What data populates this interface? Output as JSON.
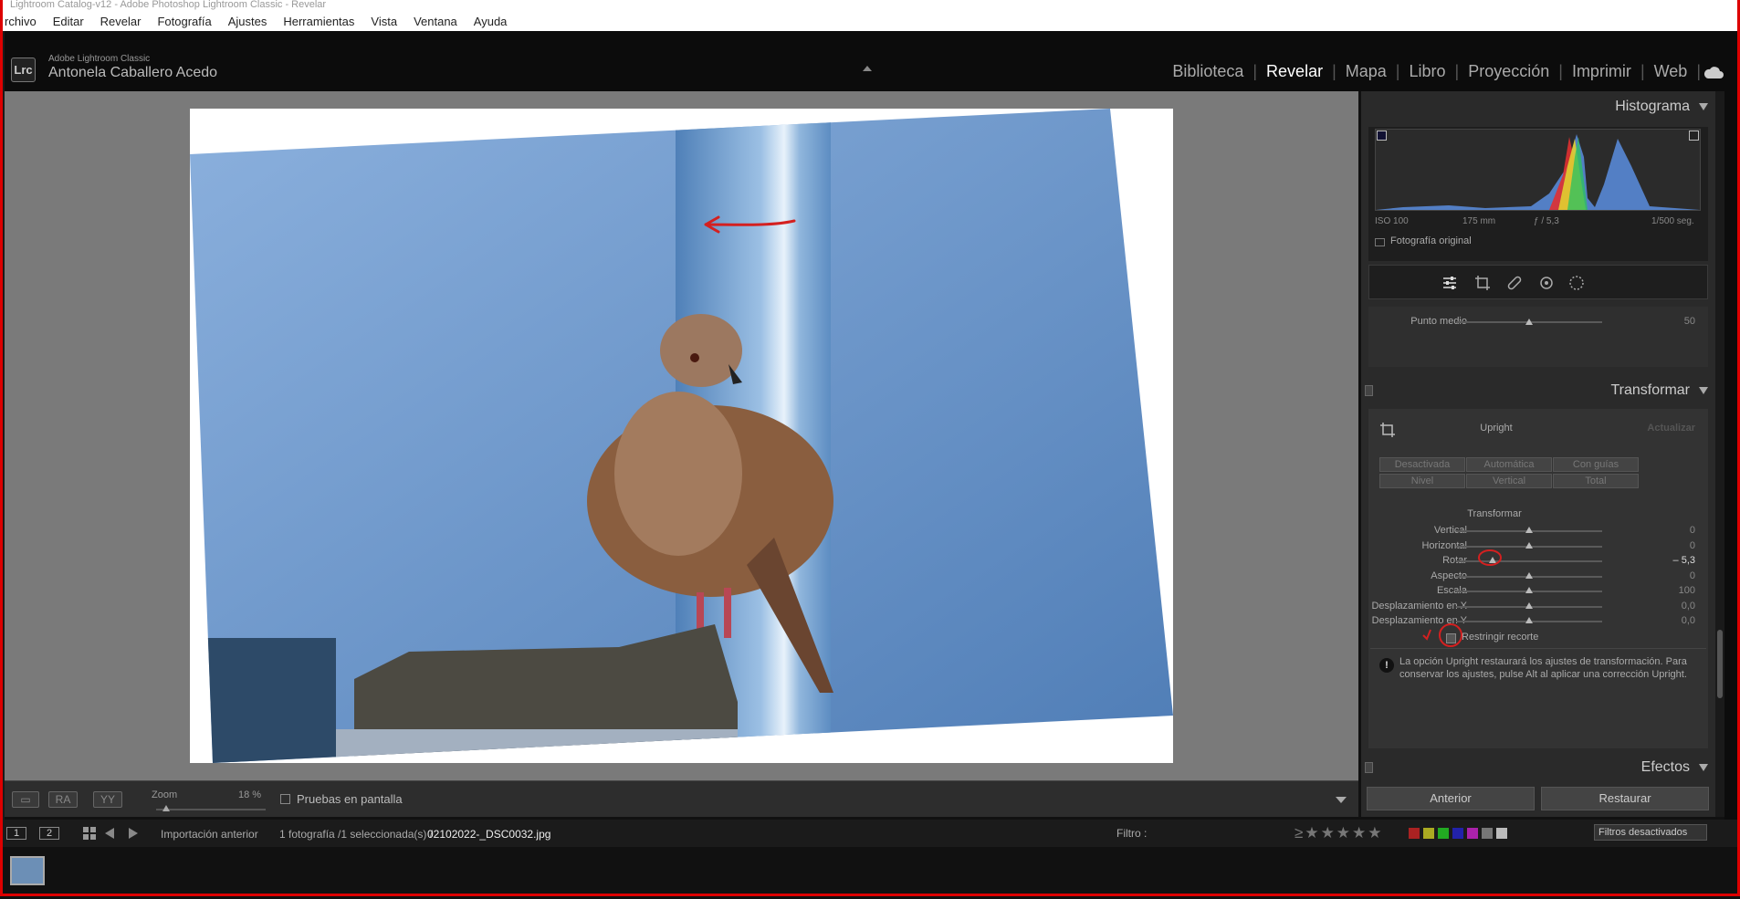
{
  "window": {
    "title": "Lightroom Catalog-v12 - Adobe Photoshop Lightroom Classic - Revelar"
  },
  "menu": [
    "rchivo",
    "Editar",
    "Revelar",
    "Fotografía",
    "Ajustes",
    "Herramientas",
    "Vista",
    "Ventana",
    "Ayuda"
  ],
  "identity": {
    "logo": "Lrc",
    "product": "Adobe Lightroom Classic",
    "user": "Antonela Caballero Acedo"
  },
  "modules": {
    "items": [
      "Biblioteca",
      "Revelar",
      "Mapa",
      "Libro",
      "Proyección",
      "Imprimir",
      "Web"
    ],
    "active": "Revelar"
  },
  "toolbar": {
    "zoom_label": "Zoom",
    "zoom_value": "18 %",
    "zoom_level": 0.18,
    "softproof_label": "Pruebas en pantalla"
  },
  "histogram": {
    "title": "Histograma",
    "iso": "ISO 100",
    "focal": "175 mm",
    "aperture": "ƒ / 5,3",
    "shutter": "1/500 seg.",
    "original_label": "Fotografía original"
  },
  "tone_remnant": {
    "midpoint_label": "Punto medio",
    "midpoint_value": "50"
  },
  "transform": {
    "title": "Transformar",
    "upright_label": "Upright",
    "update_label": "Actualizar",
    "upright_buttons": [
      "Desactivada",
      "Automática",
      "Con guías",
      "Nivel",
      "Vertical",
      "Total"
    ],
    "section_label": "Transformar",
    "sliders": [
      {
        "label": "Vertical",
        "value": "0",
        "pos": 0.5
      },
      {
        "label": "Horizontal",
        "value": "0",
        "pos": 0.5
      },
      {
        "label": "Rotar",
        "value": "– 5,3",
        "pos": 0.25
      },
      {
        "label": "Aspecto",
        "value": "0",
        "pos": 0.5
      },
      {
        "label": "Escala",
        "value": "100",
        "pos": 0.5
      },
      {
        "label": "Desplazamiento en X",
        "value": "0,0",
        "pos": 0.5
      },
      {
        "label": "Desplazamiento en Y",
        "value": "0,0",
        "pos": 0.5
      }
    ],
    "constrain_label": "Restringir recorte",
    "notice": "La opción Upright restaurará los ajustes de transformación. Para conservar los ajustes, pulse Alt al aplicar una corrección Upright."
  },
  "effects": {
    "title": "Efectos"
  },
  "panel_buttons": {
    "previous": "Anterior",
    "reset": "Restaurar"
  },
  "filmstrip": {
    "page1": "1",
    "page2": "2",
    "source": "Importación anterior",
    "count": "1 fotografía /1 seleccionada(s) /",
    "filename": "02102022-_DSC0032.jpg",
    "filter_label": "Filtro :",
    "filter_state": "Filtros desactivados"
  },
  "colors": {
    "accent_annotation": "#d42020",
    "sky": "#7ea2d0",
    "panel_bg": "#2a2a2a"
  }
}
